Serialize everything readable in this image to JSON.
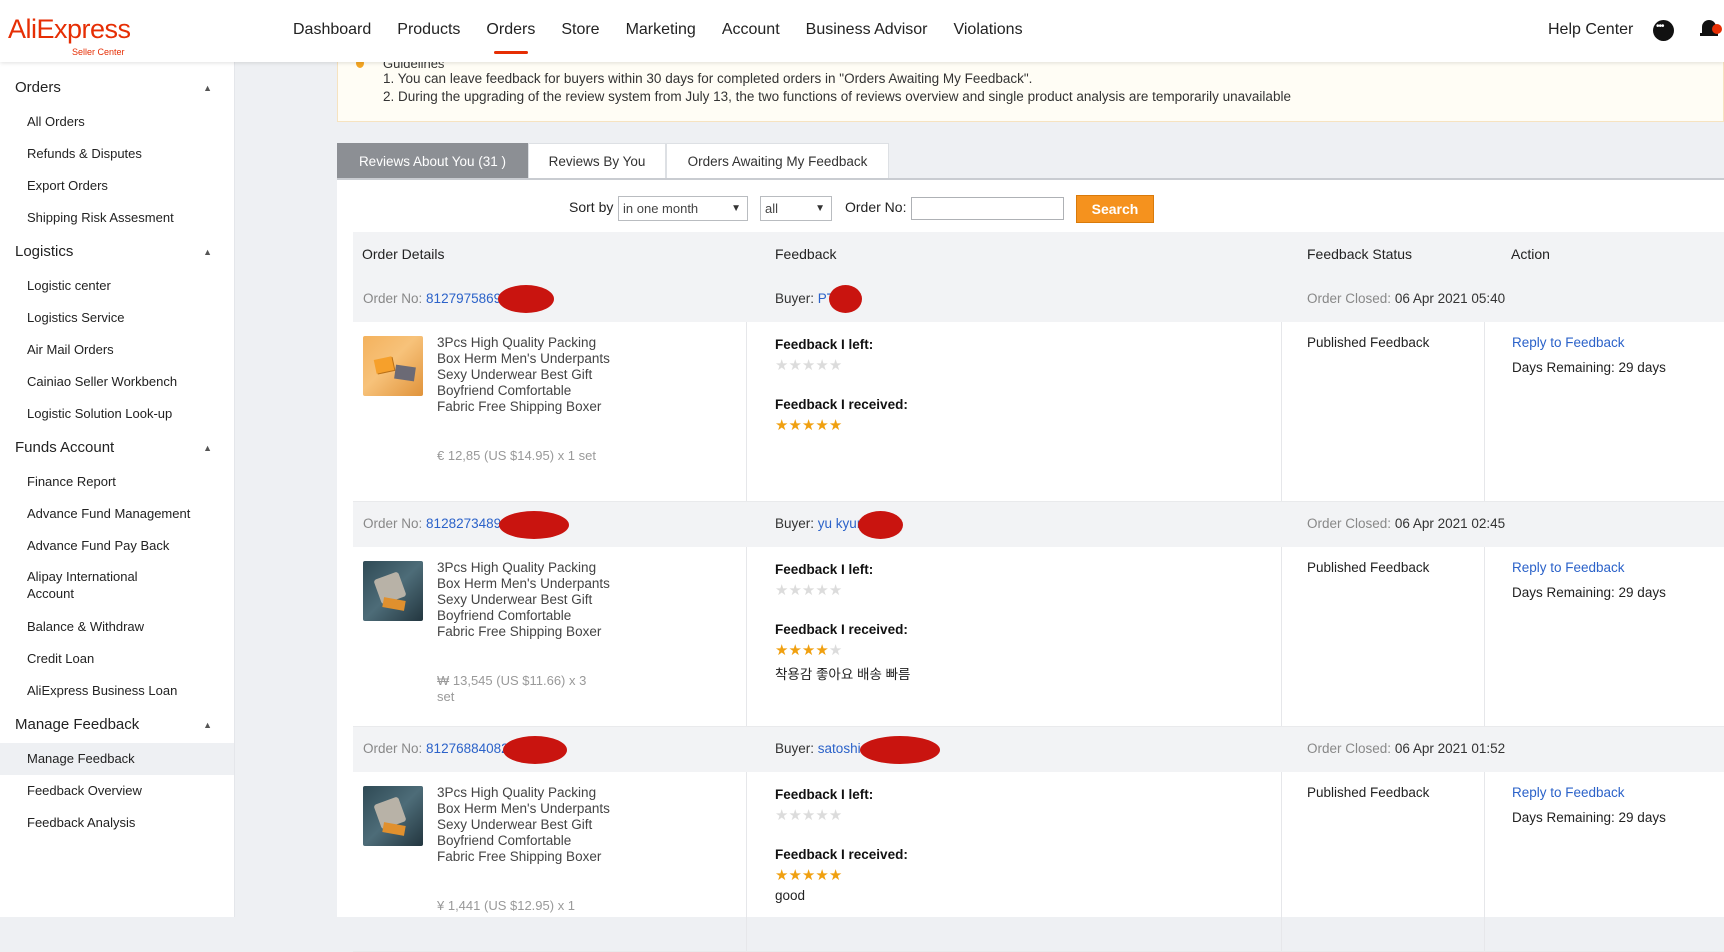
{
  "header": {
    "logo": "AliExpress",
    "logo_sub": "Seller Center",
    "nav": [
      "Dashboard",
      "Products",
      "Orders",
      "Store",
      "Marketing",
      "Account",
      "Business Advisor",
      "Violations"
    ],
    "active_nav": "Orders",
    "help": "Help Center"
  },
  "sidebar": {
    "groups": [
      {
        "title": "Orders",
        "items": [
          "All Orders",
          "Refunds & Disputes",
          "Export Orders",
          "Shipping Risk Assesment"
        ]
      },
      {
        "title": "Logistics",
        "items": [
          "Logistic center",
          "Logistics Service",
          "Air Mail Orders",
          "Cainiao Seller Workbench",
          "Logistic Solution Look-up"
        ]
      },
      {
        "title": "Funds Account",
        "items": [
          "Finance Report",
          "Advance Fund Management",
          "Advance Fund Pay Back",
          "Alipay International Account",
          "Balance & Withdraw",
          "Credit Loan",
          "AliExpress Business Loan"
        ]
      },
      {
        "title": "Manage Feedback",
        "items": [
          "Manage Feedback",
          "Feedback Overview",
          "Feedback Analysis"
        ]
      }
    ],
    "active_item": "Manage Feedback"
  },
  "guidelines": {
    "title": "Guidelines",
    "lines": [
      "1. You can leave feedback for buyers within 30 days for completed orders in \"Orders Awaiting My Feedback\".",
      "2. During the upgrading of the review system from July 13, the two functions of reviews overview and single product analysis are temporarily unavailable"
    ]
  },
  "tabs": [
    "Reviews About You (31 )",
    "Reviews By You",
    "Orders Awaiting My Feedback"
  ],
  "filters": {
    "sort_label": "Sort by",
    "sort_value": "in one month",
    "type_value": "all",
    "order_label": "Order No:",
    "order_value": "",
    "search_label": "Search"
  },
  "table_headers": [
    "Order Details",
    "Feedback",
    "Feedback Status",
    "Action"
  ],
  "labels": {
    "order_no": "Order No:",
    "buyer": "Buyer:",
    "order_closed": "Order Closed:",
    "feedback_left": "Feedback I left:",
    "feedback_received": "Feedback I received:"
  },
  "orders": [
    {
      "order_no": "8127975869",
      "buyer": "PT",
      "closed": "06 Apr 2021 05:40",
      "product_title": "3Pcs High Quality Packing Box Herm Men's Underpants Sexy Underwear Best Gift Boyfriend Comfortable Fabric Free Shipping Boxer",
      "price": "€ 12,85 (US $14.95) x 1 set",
      "left_stars": 0,
      "received_stars": 5,
      "comment": "",
      "status": "Published Feedback",
      "action": "Reply to Feedback",
      "days": "Days Remaining: 29 days"
    },
    {
      "order_no": "8128273489",
      "buyer": "yu kyun",
      "closed": "06 Apr 2021 02:45",
      "product_title": "3Pcs High Quality Packing Box Herm Men's Underpants Sexy Underwear Best Gift Boyfriend Comfortable Fabric Free Shipping Boxer",
      "price": "₩ 13,545 (US $11.66) x 3 set",
      "left_stars": 0,
      "received_stars": 4,
      "comment": "착용감 좋아요 배송 빠름",
      "status": "Published Feedback",
      "action": "Reply to Feedback",
      "days": "Days Remaining: 29 days"
    },
    {
      "order_no": "81276884082",
      "buyer": "satoshi",
      "closed": "06 Apr 2021 01:52",
      "product_title": "3Pcs High Quality Packing Box Herm Men's Underpants Sexy Underwear Best Gift Boyfriend Comfortable Fabric Free Shipping Boxer",
      "price": "¥ 1,441 (US $12.95) x 1",
      "left_stars": 0,
      "received_stars": 5,
      "comment": "good",
      "status": "Published Feedback",
      "action": "Reply to Feedback",
      "days": "Days Remaining: 29 days"
    }
  ],
  "colors": {
    "brand": "#e62e04",
    "search_button": "#f5921e",
    "link": "#2b62c9",
    "star": "#f0a010",
    "redaction": "#c9140f"
  }
}
